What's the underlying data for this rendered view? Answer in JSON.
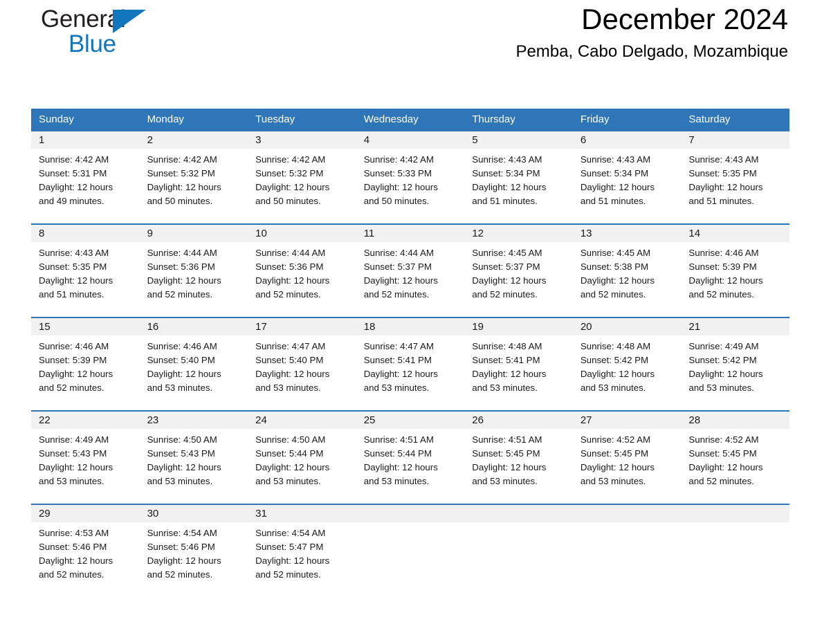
{
  "brand": {
    "name_part1": "General",
    "name_part2": "Blue",
    "triangle_icon": "triangle-icon",
    "colors": {
      "black": "#231f20",
      "blue": "#1276bd"
    }
  },
  "header": {
    "title": "December 2024",
    "location": "Pemba, Cabo Delgado, Mozambique"
  },
  "theme": {
    "header_blue": "#2f76b9",
    "daynum_band": "#f1f1f1",
    "text": "#1a1a1a"
  },
  "calendar": {
    "weekday_headers": [
      "Sunday",
      "Monday",
      "Tuesday",
      "Wednesday",
      "Thursday",
      "Friday",
      "Saturday"
    ],
    "weeks": [
      [
        {
          "day": "1",
          "sunrise": "Sunrise: 4:42 AM",
          "sunset": "Sunset: 5:31 PM",
          "daylight_line1": "Daylight: 12 hours",
          "daylight_line2": "and 49 minutes."
        },
        {
          "day": "2",
          "sunrise": "Sunrise: 4:42 AM",
          "sunset": "Sunset: 5:32 PM",
          "daylight_line1": "Daylight: 12 hours",
          "daylight_line2": "and 50 minutes."
        },
        {
          "day": "3",
          "sunrise": "Sunrise: 4:42 AM",
          "sunset": "Sunset: 5:32 PM",
          "daylight_line1": "Daylight: 12 hours",
          "daylight_line2": "and 50 minutes."
        },
        {
          "day": "4",
          "sunrise": "Sunrise: 4:42 AM",
          "sunset": "Sunset: 5:33 PM",
          "daylight_line1": "Daylight: 12 hours",
          "daylight_line2": "and 50 minutes."
        },
        {
          "day": "5",
          "sunrise": "Sunrise: 4:43 AM",
          "sunset": "Sunset: 5:34 PM",
          "daylight_line1": "Daylight: 12 hours",
          "daylight_line2": "and 51 minutes."
        },
        {
          "day": "6",
          "sunrise": "Sunrise: 4:43 AM",
          "sunset": "Sunset: 5:34 PM",
          "daylight_line1": "Daylight: 12 hours",
          "daylight_line2": "and 51 minutes."
        },
        {
          "day": "7",
          "sunrise": "Sunrise: 4:43 AM",
          "sunset": "Sunset: 5:35 PM",
          "daylight_line1": "Daylight: 12 hours",
          "daylight_line2": "and 51 minutes."
        }
      ],
      [
        {
          "day": "8",
          "sunrise": "Sunrise: 4:43 AM",
          "sunset": "Sunset: 5:35 PM",
          "daylight_line1": "Daylight: 12 hours",
          "daylight_line2": "and 51 minutes."
        },
        {
          "day": "9",
          "sunrise": "Sunrise: 4:44 AM",
          "sunset": "Sunset: 5:36 PM",
          "daylight_line1": "Daylight: 12 hours",
          "daylight_line2": "and 52 minutes."
        },
        {
          "day": "10",
          "sunrise": "Sunrise: 4:44 AM",
          "sunset": "Sunset: 5:36 PM",
          "daylight_line1": "Daylight: 12 hours",
          "daylight_line2": "and 52 minutes."
        },
        {
          "day": "11",
          "sunrise": "Sunrise: 4:44 AM",
          "sunset": "Sunset: 5:37 PM",
          "daylight_line1": "Daylight: 12 hours",
          "daylight_line2": "and 52 minutes."
        },
        {
          "day": "12",
          "sunrise": "Sunrise: 4:45 AM",
          "sunset": "Sunset: 5:37 PM",
          "daylight_line1": "Daylight: 12 hours",
          "daylight_line2": "and 52 minutes."
        },
        {
          "day": "13",
          "sunrise": "Sunrise: 4:45 AM",
          "sunset": "Sunset: 5:38 PM",
          "daylight_line1": "Daylight: 12 hours",
          "daylight_line2": "and 52 minutes."
        },
        {
          "day": "14",
          "sunrise": "Sunrise: 4:46 AM",
          "sunset": "Sunset: 5:39 PM",
          "daylight_line1": "Daylight: 12 hours",
          "daylight_line2": "and 52 minutes."
        }
      ],
      [
        {
          "day": "15",
          "sunrise": "Sunrise: 4:46 AM",
          "sunset": "Sunset: 5:39 PM",
          "daylight_line1": "Daylight: 12 hours",
          "daylight_line2": "and 52 minutes."
        },
        {
          "day": "16",
          "sunrise": "Sunrise: 4:46 AM",
          "sunset": "Sunset: 5:40 PM",
          "daylight_line1": "Daylight: 12 hours",
          "daylight_line2": "and 53 minutes."
        },
        {
          "day": "17",
          "sunrise": "Sunrise: 4:47 AM",
          "sunset": "Sunset: 5:40 PM",
          "daylight_line1": "Daylight: 12 hours",
          "daylight_line2": "and 53 minutes."
        },
        {
          "day": "18",
          "sunrise": "Sunrise: 4:47 AM",
          "sunset": "Sunset: 5:41 PM",
          "daylight_line1": "Daylight: 12 hours",
          "daylight_line2": "and 53 minutes."
        },
        {
          "day": "19",
          "sunrise": "Sunrise: 4:48 AM",
          "sunset": "Sunset: 5:41 PM",
          "daylight_line1": "Daylight: 12 hours",
          "daylight_line2": "and 53 minutes."
        },
        {
          "day": "20",
          "sunrise": "Sunrise: 4:48 AM",
          "sunset": "Sunset: 5:42 PM",
          "daylight_line1": "Daylight: 12 hours",
          "daylight_line2": "and 53 minutes."
        },
        {
          "day": "21",
          "sunrise": "Sunrise: 4:49 AM",
          "sunset": "Sunset: 5:42 PM",
          "daylight_line1": "Daylight: 12 hours",
          "daylight_line2": "and 53 minutes."
        }
      ],
      [
        {
          "day": "22",
          "sunrise": "Sunrise: 4:49 AM",
          "sunset": "Sunset: 5:43 PM",
          "daylight_line1": "Daylight: 12 hours",
          "daylight_line2": "and 53 minutes."
        },
        {
          "day": "23",
          "sunrise": "Sunrise: 4:50 AM",
          "sunset": "Sunset: 5:43 PM",
          "daylight_line1": "Daylight: 12 hours",
          "daylight_line2": "and 53 minutes."
        },
        {
          "day": "24",
          "sunrise": "Sunrise: 4:50 AM",
          "sunset": "Sunset: 5:44 PM",
          "daylight_line1": "Daylight: 12 hours",
          "daylight_line2": "and 53 minutes."
        },
        {
          "day": "25",
          "sunrise": "Sunrise: 4:51 AM",
          "sunset": "Sunset: 5:44 PM",
          "daylight_line1": "Daylight: 12 hours",
          "daylight_line2": "and 53 minutes."
        },
        {
          "day": "26",
          "sunrise": "Sunrise: 4:51 AM",
          "sunset": "Sunset: 5:45 PM",
          "daylight_line1": "Daylight: 12 hours",
          "daylight_line2": "and 53 minutes."
        },
        {
          "day": "27",
          "sunrise": "Sunrise: 4:52 AM",
          "sunset": "Sunset: 5:45 PM",
          "daylight_line1": "Daylight: 12 hours",
          "daylight_line2": "and 53 minutes."
        },
        {
          "day": "28",
          "sunrise": "Sunrise: 4:52 AM",
          "sunset": "Sunset: 5:45 PM",
          "daylight_line1": "Daylight: 12 hours",
          "daylight_line2": "and 52 minutes."
        }
      ],
      [
        {
          "day": "29",
          "sunrise": "Sunrise: 4:53 AM",
          "sunset": "Sunset: 5:46 PM",
          "daylight_line1": "Daylight: 12 hours",
          "daylight_line2": "and 52 minutes."
        },
        {
          "day": "30",
          "sunrise": "Sunrise: 4:54 AM",
          "sunset": "Sunset: 5:46 PM",
          "daylight_line1": "Daylight: 12 hours",
          "daylight_line2": "and 52 minutes."
        },
        {
          "day": "31",
          "sunrise": "Sunrise: 4:54 AM",
          "sunset": "Sunset: 5:47 PM",
          "daylight_line1": "Daylight: 12 hours",
          "daylight_line2": "and 52 minutes."
        },
        {
          "day": "",
          "sunrise": "",
          "sunset": "",
          "daylight_line1": "",
          "daylight_line2": ""
        },
        {
          "day": "",
          "sunrise": "",
          "sunset": "",
          "daylight_line1": "",
          "daylight_line2": ""
        },
        {
          "day": "",
          "sunrise": "",
          "sunset": "",
          "daylight_line1": "",
          "daylight_line2": ""
        },
        {
          "day": "",
          "sunrise": "",
          "sunset": "",
          "daylight_line1": "",
          "daylight_line2": ""
        }
      ]
    ]
  }
}
